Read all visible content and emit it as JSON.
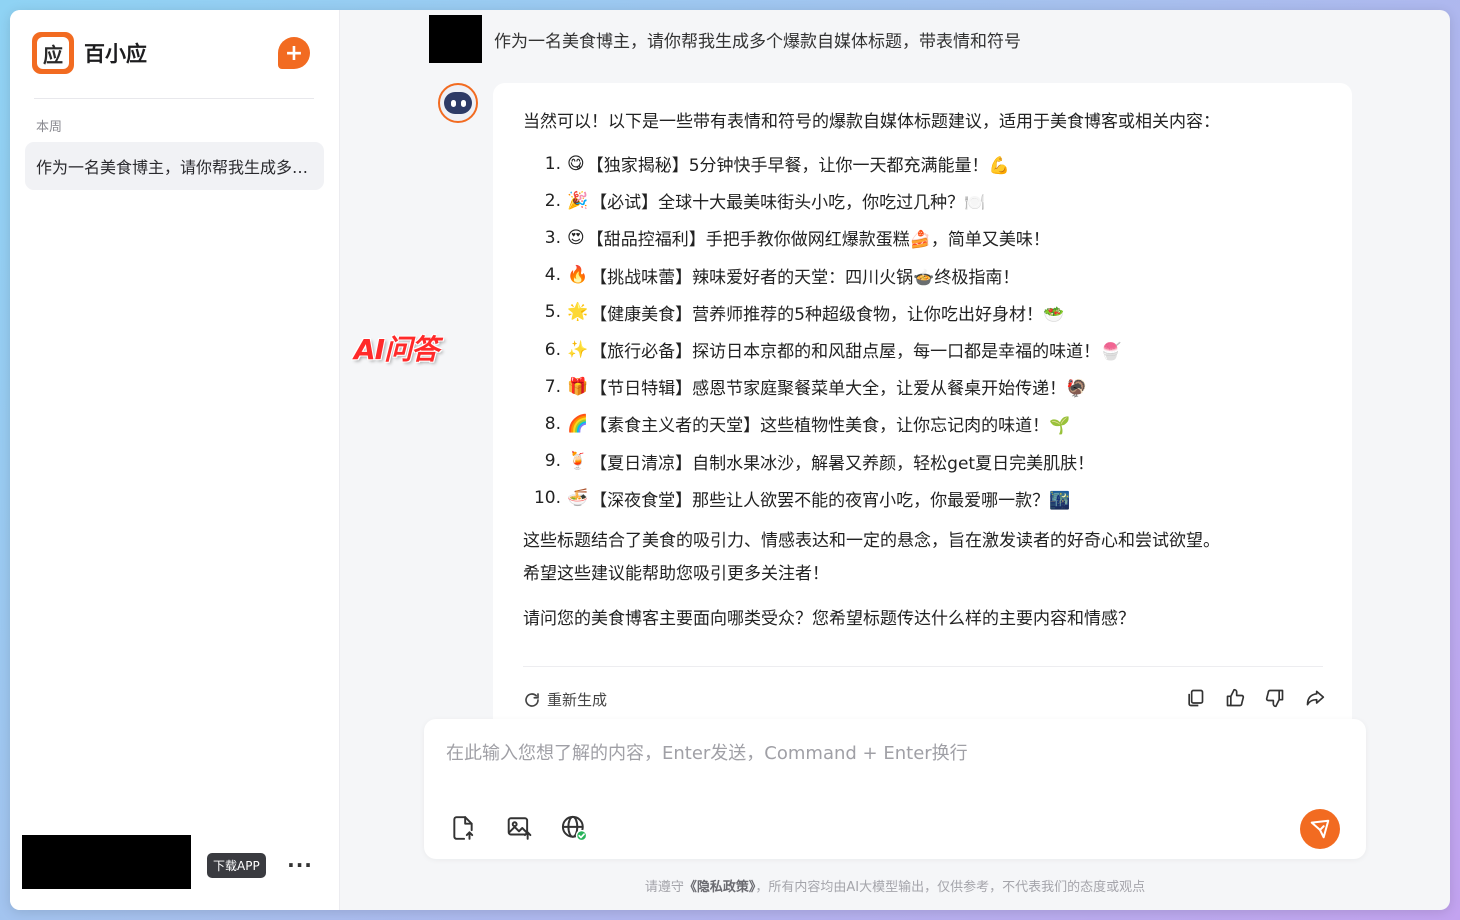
{
  "sidebar": {
    "logo_char": "应",
    "app_name": "百小应",
    "new_chat_symbol": "+",
    "section_label": "本周",
    "history": [
      {
        "title": "作为一名美食博主，请你帮我生成多个爆款自媒体标题，带表情和符号"
      }
    ],
    "download_label": "下载APP",
    "more_label": "···"
  },
  "conversation": {
    "user_message": "作为一名美食博主，请你帮我生成多个爆款自媒体标题，带表情和符号",
    "overlay_label": "AI问答",
    "answer": {
      "intro": "当然可以！以下是一些带有表情和符号的爆款自媒体标题建议，适用于美食博客或相关内容：",
      "items": [
        {
          "num": "1.",
          "emoji": "😋",
          "text": "【独家揭秘】5分钟快手早餐，让你一天都充满能量！💪"
        },
        {
          "num": "2.",
          "emoji": "🎉",
          "text": "【必试】全球十大最美味街头小吃，你吃过几种？🍽️"
        },
        {
          "num": "3.",
          "emoji": "😍",
          "text": "【甜品控福利】手把手教你做网红爆款蛋糕🍰，简单又美味！"
        },
        {
          "num": "4.",
          "emoji": "🔥",
          "text": "【挑战味蕾】辣味爱好者的天堂：四川火锅🍲终极指南！"
        },
        {
          "num": "5.",
          "emoji": "🌟",
          "text": "【健康美食】营养师推荐的5种超级食物，让你吃出好身材！🥗"
        },
        {
          "num": "6.",
          "emoji": "✨",
          "text": "【旅行必备】探访日本京都的和风甜点屋，每一口都是幸福的味道！🍧"
        },
        {
          "num": "7.",
          "emoji": "🎁",
          "text": "【节日特辑】感恩节家庭聚餐菜单大全，让爱从餐桌开始传递！🦃"
        },
        {
          "num": "8.",
          "emoji": "🌈",
          "text": "【素食主义者的天堂】这些植物性美食，让你忘记肉的味道！🌱"
        },
        {
          "num": "9.",
          "emoji": "🍹",
          "text": "【夏日清凉】自制水果冰沙，解暑又养颜，轻松get夏日完美肌肤！"
        },
        {
          "num": "10.",
          "emoji": "🍜",
          "text": "【深夜食堂】那些让人欲罢不能的夜宵小吃，你最爱哪一款？🌃"
        }
      ],
      "paragraph1_line1": "这些标题结合了美食的吸引力、情感表达和一定的悬念，旨在激发读者的好奇心和尝试欲望。",
      "paragraph1_line2": "希望这些建议能帮助您吸引更多关注者！",
      "paragraph2": "请问您的美食博客主要面向哪类受众？您希望标题传达什么样的主要内容和情感？",
      "regenerate_label": "重新生成"
    }
  },
  "input": {
    "placeholder": "在此输入您想了解的内容，Enter发送，Command + Enter换行",
    "value": ""
  },
  "footer": {
    "prefix": "请遵守",
    "policy_link": "《隐私政策》",
    "suffix": "，所有内容均由AI大模型输出，仅供参考，不代表我们的态度或观点"
  },
  "icons": {
    "accent": "#f26b21",
    "regenerate": "refresh-icon",
    "copy": "copy-icon",
    "like": "thumbs-up-icon",
    "dislike": "thumbs-down-icon",
    "share": "share-icon",
    "upload_file": "file-upload-icon",
    "upload_image": "image-upload-icon",
    "web_search": "globe-check-icon",
    "send": "send-icon"
  }
}
